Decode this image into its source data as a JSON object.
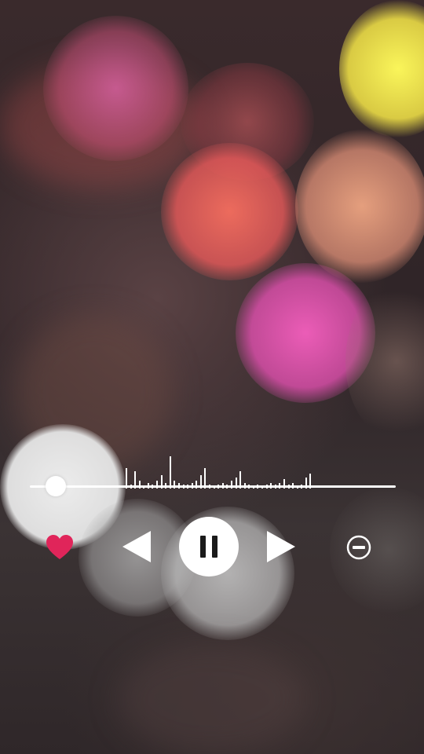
{
  "player": {
    "playback_state": "playing",
    "progress_fraction": 0.05,
    "liked": true,
    "visualizer_levels": [
      0.55,
      0.1,
      0.45,
      0.2,
      0.05,
      0.15,
      0.1,
      0.2,
      0.35,
      0.15,
      0.85,
      0.2,
      0.15,
      0.1,
      0.1,
      0.15,
      0.2,
      0.35,
      0.55,
      0.1,
      0.05,
      0.1,
      0.15,
      0.1,
      0.2,
      0.3,
      0.45,
      0.15,
      0.1,
      0.05,
      0.1,
      0.05,
      0.1,
      0.15,
      0.1,
      0.15,
      0.25,
      0.1,
      0.15,
      0.05,
      0.1,
      0.3,
      0.4
    ]
  },
  "icons": {
    "heart": "heart-icon",
    "previous": "previous-icon",
    "pause": "pause-icon",
    "next": "next-icon",
    "remove": "minus-circle-icon"
  },
  "colors": {
    "accent": "#e0255a",
    "controls": "#ffffff"
  }
}
